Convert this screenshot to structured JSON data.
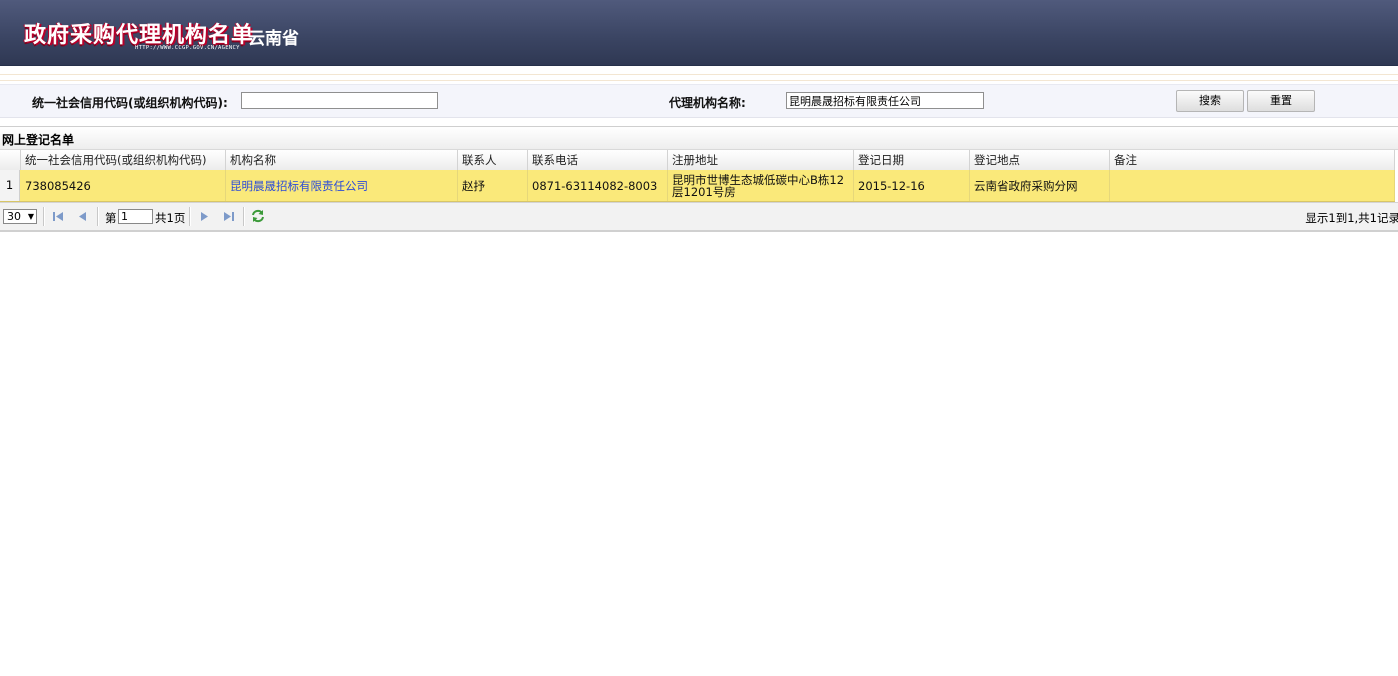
{
  "header": {
    "title": "政府采购代理机构名单",
    "url": "HTTP://WWW.CCGP.GOV.CN/AGENCY",
    "province": "云南省"
  },
  "search": {
    "code_label": "统一社会信用代码(或组织机构代码):",
    "code_value": "",
    "name_label": "代理机构名称:",
    "name_value": "昆明晨晟招标有限责任公司",
    "search_button": "搜索",
    "reset_button": "重置"
  },
  "panel": {
    "title": "网上登记名单"
  },
  "grid": {
    "columns": [
      "统一社会信用代码(或组织机构代码)",
      "机构名称",
      "联系人",
      "联系电话",
      "注册地址",
      "登记日期",
      "登记地点",
      "备注"
    ],
    "rows": [
      {
        "index": "1",
        "code": "738085426",
        "name": "昆明晨晟招标有限责任公司",
        "contact": "赵抒",
        "phone": "0871-63114082-8003",
        "address": "昆明市世博生态城低碳中心B栋12层1201号房",
        "date": "2015-12-16",
        "location": "云南省政府采购分网",
        "note": ""
      }
    ]
  },
  "pager": {
    "page_size": "30",
    "page_prefix": "第",
    "page_value": "1",
    "page_suffix": "共1页",
    "info": "显示1到1,共1记录"
  },
  "colors": {
    "header_bg": "#3a4462",
    "selected_row": "#fae97a",
    "link": "#2b4bd8",
    "logo_shadow": "#b8002a"
  }
}
